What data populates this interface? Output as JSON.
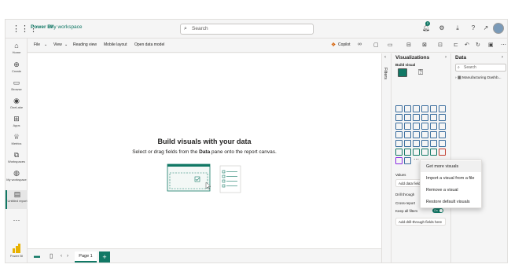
{
  "topbar": {
    "app_title": "Power BI",
    "workspace": "My workspace",
    "search_placeholder": "Search",
    "notification_count": "2"
  },
  "leftnav": {
    "items": [
      {
        "label": "Home",
        "icon": "home-icon"
      },
      {
        "label": "Create",
        "icon": "plus-circle-icon"
      },
      {
        "label": "Browse",
        "icon": "folder-icon"
      },
      {
        "label": "OneLake",
        "icon": "onelake-icon"
      },
      {
        "label": "Apps",
        "icon": "apps-icon"
      },
      {
        "label": "Metrics",
        "icon": "trophy-icon"
      },
      {
        "label": "Workspaces",
        "icon": "workspaces-icon"
      },
      {
        "label": "My workspace",
        "icon": "person-workspace-icon"
      },
      {
        "label": "Untitled report",
        "icon": "report-icon"
      }
    ],
    "more": "···",
    "footer_label": "Power BI"
  },
  "ribbon": {
    "file": "File",
    "view": "View",
    "reading_view": "Reading view",
    "mobile_layout": "Mobile layout",
    "open_data_model": "Open data model",
    "copilot": "Copilot"
  },
  "canvas": {
    "title": "Build visuals with your data",
    "sub_pre": "Select or drag fields from the ",
    "sub_bold": "Data",
    "sub_post": " pane onto the report canvas."
  },
  "filters": {
    "label": "Filters"
  },
  "visualizations": {
    "title": "Visualizations",
    "build_label": "Build visual",
    "values_label": "Values",
    "add_data_fields": "Add data fields here",
    "drill_through": "Drill through",
    "cross_report": "Cross-report",
    "keep_all_filters": "Keep all filters",
    "toggle_on": "On",
    "add_drill_through": "Add drill-through fields here"
  },
  "context_menu": {
    "items": [
      "Get more visuals",
      "Import a visual from a file",
      "Remove a visual",
      "Restore default visuals"
    ]
  },
  "data_pane": {
    "title": "Data",
    "search_placeholder": "Search",
    "table_name": "Manufacturing Dashb..."
  },
  "bottom": {
    "page_tab": "Page 1",
    "add_page": "+"
  },
  "colors": {
    "accent": "#117865",
    "background": "#f5f5f5",
    "canvas": "#ffffff"
  }
}
